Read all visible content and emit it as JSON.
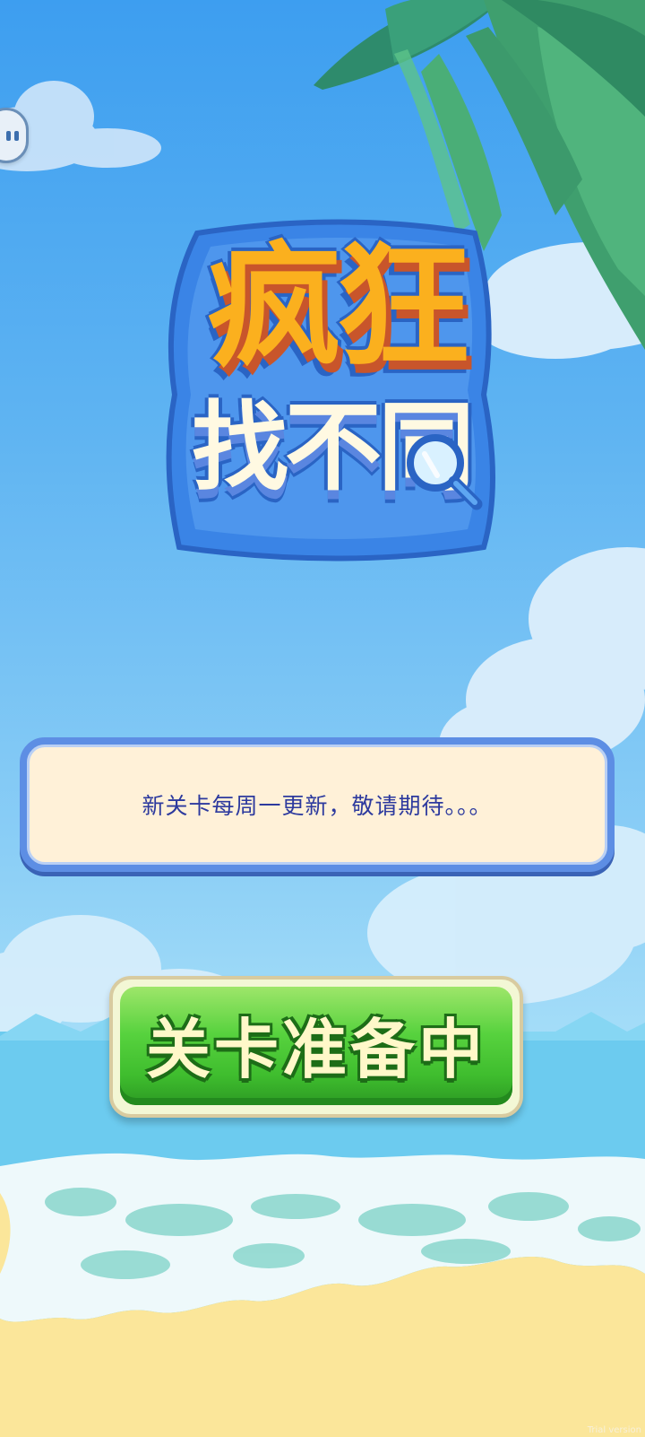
{
  "logo": {
    "line1": "疯狂",
    "line2": "找不同"
  },
  "notice": {
    "text": "新关卡每周一更新，敬请期待。。。"
  },
  "main_button": {
    "label": "关卡准备中"
  },
  "watermark": "Trial version",
  "colors": {
    "sky_top": "#3d9ef0",
    "sky_bottom": "#a6def8",
    "sand": "#fbe69a",
    "logo_orange": "#fbb01e",
    "logo_blue": "#2a64c4",
    "notice_text": "#2d3a9e",
    "button_green": "#3fbd2e"
  },
  "icons": {
    "menu": "menu-dots-icon",
    "magnifier": "magnifier-icon"
  }
}
